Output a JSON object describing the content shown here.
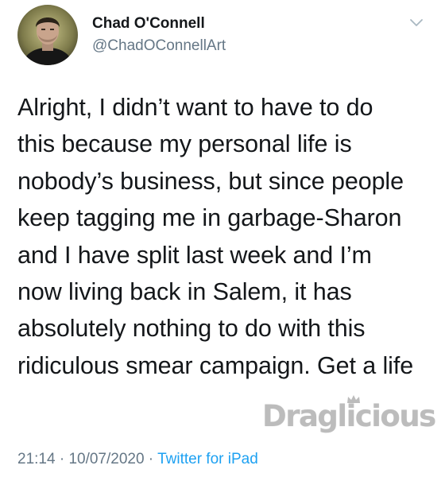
{
  "author": {
    "name": "Chad O'Connell",
    "handle": "@ChadOConnellArt"
  },
  "tweet": {
    "lines": [
      "Alright, I didn’t want to have to do",
      "this because my personal life is",
      "nobody’s business, but since people",
      "keep tagging me in garbage-Sharon",
      "and I have split last week and I’m",
      "now living back in Salem, it has",
      "absolutely nothing to do with this",
      "ridiculous smear campaign. Get a life"
    ],
    "time": "21:14",
    "separator1": " · ",
    "date": "10/07/2020",
    "separator2": " · ",
    "source": "Twitter for iPad"
  },
  "watermark": {
    "text": "Draglicious"
  },
  "icons": {
    "menu": "chevron-down-icon",
    "avatar": "profile-photo"
  },
  "colors": {
    "text": "#14171a",
    "muted": "#657786",
    "link": "#1da1f2",
    "watermark": "#bcbcbc"
  }
}
